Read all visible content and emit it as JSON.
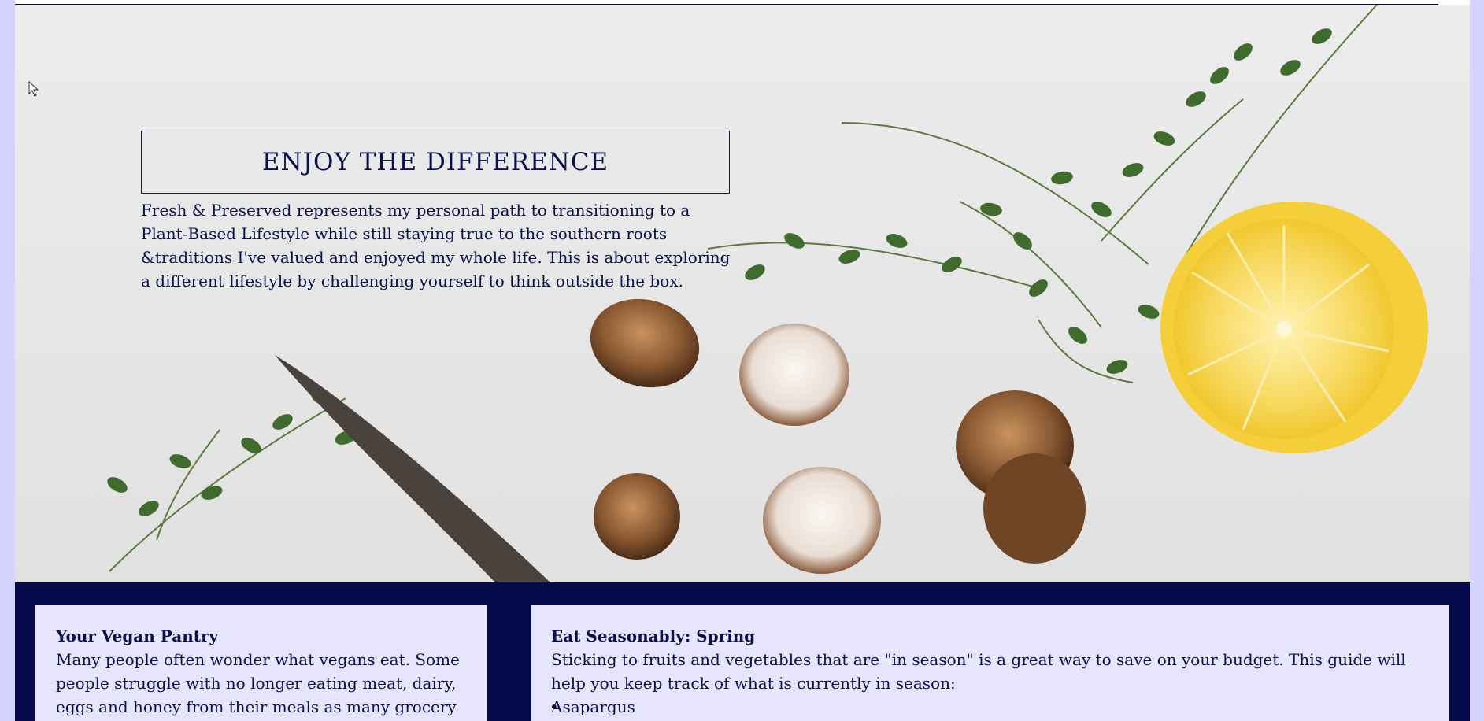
{
  "hero": {
    "headline": "ENJOY THE DIFFERENCE",
    "intro": "Fresh & Preserved represents my personal path to transitioning to a Plant-Based Lifestyle while still staying true to the southern roots &traditions I've valued and enjoyed my whole life. This is about exploring a different lifestyle by challenging yourself to think outside the box."
  },
  "pantry": {
    "title": "Your Vegan Pantry",
    "text": "Many people often wonder what vegans eat. Some people struggle with no longer eating meat, dairy, eggs and honey from their meals as many grocery"
  },
  "seasonal": {
    "title": "Eat Seasonably: Spring",
    "text": "Sticking to fruits and vegetables that are \"in season\" is a great way to save on your budget. This guide will help you keep track of what is currently in season:",
    "items": [
      "Asapargus"
    ]
  },
  "colors": {
    "navy": "#060a4a",
    "card_bg": "#e6e5fd",
    "page_bg": "#d3d3fb"
  },
  "icons": {
    "cursor": "arrow-cursor-icon"
  }
}
